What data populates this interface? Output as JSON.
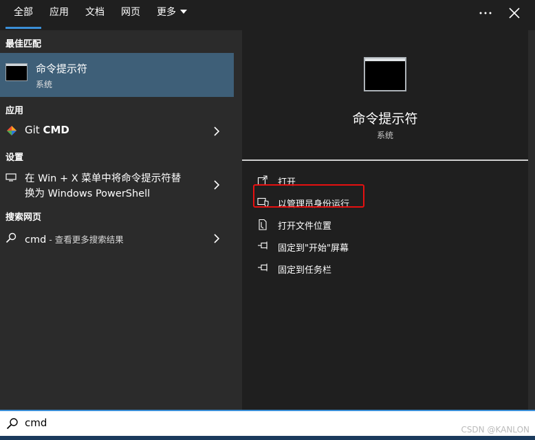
{
  "tabs": [
    {
      "label": "全部",
      "active": true
    },
    {
      "label": "应用"
    },
    {
      "label": "文档"
    },
    {
      "label": "网页"
    },
    {
      "label": "更多"
    }
  ],
  "top_icons": {
    "more_options": "ellipsis-icon",
    "close": "close-icon"
  },
  "left": {
    "best_match_heading": "最佳匹配",
    "best_match": {
      "title": "命令提示符",
      "subtitle": "系统",
      "icon": "cmd-icon"
    },
    "apps_heading": "应用",
    "apps": [
      {
        "label_prefix": "Git ",
        "label_bold": "CMD",
        "icon": "git-icon"
      }
    ],
    "settings_heading": "设置",
    "settings": [
      {
        "line1": "在 Win + X 菜单中将命令提示符替",
        "line2": "换为 Windows PowerShell",
        "icon": "display-icon"
      }
    ],
    "web_heading": "搜索网页",
    "web": [
      {
        "query": "cmd",
        "suffix": " - 查看更多搜索结果",
        "icon": "search-icon"
      }
    ]
  },
  "right": {
    "title": "命令提示符",
    "subtitle": "系统",
    "actions": [
      {
        "label": "打开",
        "icon": "open-icon"
      },
      {
        "label": "以管理员身份运行",
        "icon": "shield-icon"
      },
      {
        "label": "打开文件位置",
        "icon": "file-icon"
      },
      {
        "label": "固定到\"开始\"屏幕",
        "icon": "pin-icon"
      },
      {
        "label": "固定到任务栏",
        "icon": "pin-icon"
      }
    ]
  },
  "search": {
    "value": "cmd",
    "icon": "search-icon"
  },
  "watermark": "CSDN @KANLON",
  "colors": {
    "accent": "#3b8fd8",
    "selection": "#3e5f78",
    "highlight_box": "#e81010"
  }
}
